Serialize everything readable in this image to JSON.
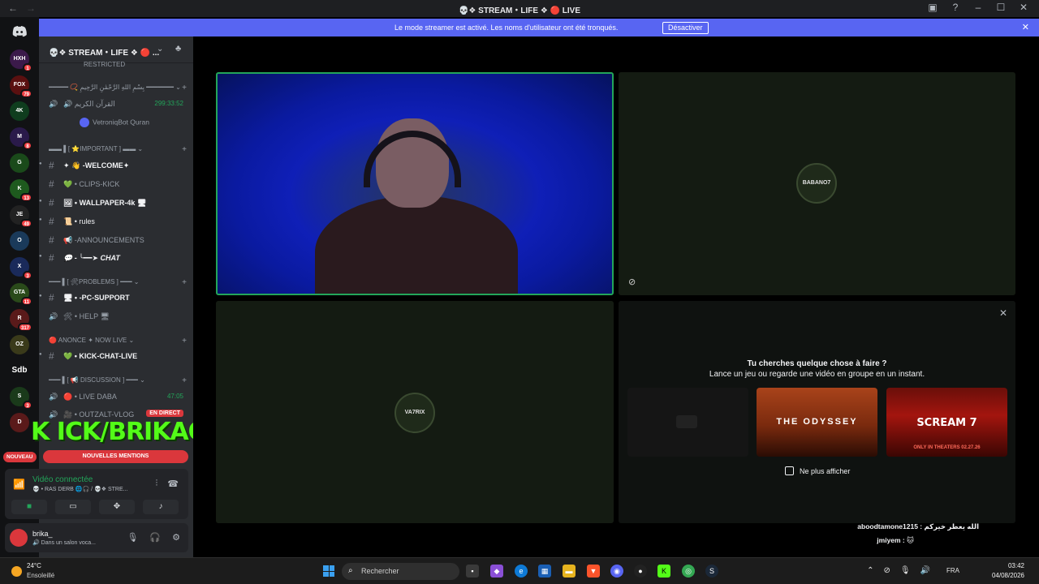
{
  "window": {
    "title": "💀❖ STREAM・LIFE ❖ 🔴 LIVE",
    "back_glyph": "←",
    "forward_glyph": "→",
    "icons": [
      "inbox-icon",
      "help-icon",
      "minimize-icon",
      "maximize-icon",
      "close-icon"
    ]
  },
  "banner": {
    "text": "Le mode streamer est activé. Les noms d'utilisateur ont été tronqués.",
    "button": "Désactiver",
    "close": "✕"
  },
  "server_rail": {
    "servers": [
      {
        "label": "HXH",
        "badge": "1",
        "color": "#3b1a4a"
      },
      {
        "label": "FOX",
        "badge": "79",
        "color": "#5a1010"
      },
      {
        "label": "4K",
        "badge": "",
        "color": "#0f3d1e"
      },
      {
        "label": "M",
        "badge": "8",
        "color": "#2a1a4a"
      },
      {
        "label": "G",
        "badge": "",
        "color": "#1a4a1a"
      },
      {
        "label": "K",
        "badge": "13",
        "color": "#1e5a1e"
      },
      {
        "label": "JE",
        "badge": "49",
        "color": "#222"
      },
      {
        "label": "O",
        "badge": "",
        "color": "#1a3a5a"
      },
      {
        "label": "X",
        "badge": "3",
        "color": "#1a2a5a"
      },
      {
        "label": "GTA",
        "badge": "11",
        "color": "#2a4a1a"
      },
      {
        "label": "R",
        "badge": "317",
        "color": "#5a1a1a"
      },
      {
        "label": "OZ",
        "badge": "",
        "color": "#3a3a1a"
      },
      {
        "label": "Sdb",
        "badge": "",
        "color": "#2b2d31"
      },
      {
        "label": "S",
        "badge": "3",
        "color": "#1a3a1a"
      },
      {
        "label": "D",
        "badge": "",
        "color": "#5a1a1a"
      }
    ]
  },
  "guild": {
    "name": "💀❖ STREAM・LIFE ❖ 🔴 ...",
    "chevron": "⌄",
    "invite_icon": "♣"
  },
  "channels": {
    "cut_top": "RESTRICTED",
    "categories": [
      {
        "label": "━━━━━ 📿 بِسْمِ اللهِ الرَّحْمَٰنِ الرَّحِيمِ ━━━━━━━ ⌄",
        "plus": "+"
      },
      {
        "label": "▬▬ ▌[ ⭐IMPORTANT ] ▬▬ ⌄",
        "plus": "+"
      },
      {
        "label": "━━━ ▌[ 🛠PROBLEMS ] ━━━ ⌄",
        "plus": "+"
      },
      {
        "label": "🔴 ANONCE ✦ NOW LIVE ⌄",
        "plus": "+"
      },
      {
        "label": "━━━ ▌[ 📢 DISCUSSION ] ━━━ ⌄",
        "plus": "+"
      }
    ],
    "items": [
      {
        "label": "🔊 القرآن الكريم",
        "right": "299:33:52",
        "sym": "🔊"
      },
      {
        "label": "✦ 👋 -WELCOME✦",
        "sym": "#"
      },
      {
        "label": "💚 • CLIPS-KICK",
        "sym": "#"
      },
      {
        "label": "🖼 • WALLPAPER-4k 🖥",
        "sym": "#"
      },
      {
        "label": "📜 • rules",
        "sym": "#"
      },
      {
        "label": "📢 -ANNOUNCEMENTS",
        "sym": "#"
      },
      {
        "label": "💬 - ╰━━➤ CHAT",
        "sym": "#"
      },
      {
        "label": "🖥 • -PC-SUPPORT",
        "sym": "#"
      },
      {
        "label": "🛠 • HELP 🖥",
        "sym": "🔊"
      },
      {
        "label": "💚 • KICK-CHAT-LIVE",
        "sym": "#"
      },
      {
        "label": "🔴 • LIVE DABA",
        "right": "47:05",
        "sym": "🔊"
      },
      {
        "label": "🎥 • OUTZALT-VLOG",
        "live": "EN DIRECT",
        "sym": "🔊"
      }
    ],
    "bot_member": "VetroniqBot Quran"
  },
  "overlay": {
    "kick_text": "K ICK/BRIKAO",
    "new_pill": "NOUVEAU",
    "mentions_pill": "NOUVELLES MENTIONS"
  },
  "voice": {
    "title": "Vidéo connectée",
    "subtitle": "💀 • RAS DERB 🌐🎧 / 💀❖ STRE...",
    "buttons": [
      "camera-icon",
      "screen-share-icon",
      "activities-icon",
      "soundboard-icon"
    ]
  },
  "user": {
    "name": "brika_",
    "status": "🔊 Dans un salon voca..."
  },
  "stream_tiles": {
    "tile2_name": "BABANO7",
    "tile3_name": "VA7RIX"
  },
  "activity": {
    "title": "Tu cherches quelque chose à faire ?",
    "subtitle": "Lance un jeu ou regarde une vidéo en groupe en un instant.",
    "cards": [
      {
        "title": "",
        "sub": ""
      },
      {
        "title": "THE ODYSSEY",
        "sub": ""
      },
      {
        "title": "SCREAM 7",
        "sub": "ONLY IN THEATERS 02.27.26"
      }
    ],
    "checkbox_label": "Ne plus afficher"
  },
  "chat_overlay": [
    {
      "text": "aboodtamone1215 : الله يعطر خيركم"
    },
    {
      "text": "jmiyem : 🐱"
    }
  ],
  "taskbar": {
    "weather_temp": "24°C",
    "weather_desc": "Ensoleillé",
    "search_placeholder": "Rechercher",
    "lang": "FRA",
    "time": "03:42",
    "date": "04/08/2026"
  }
}
